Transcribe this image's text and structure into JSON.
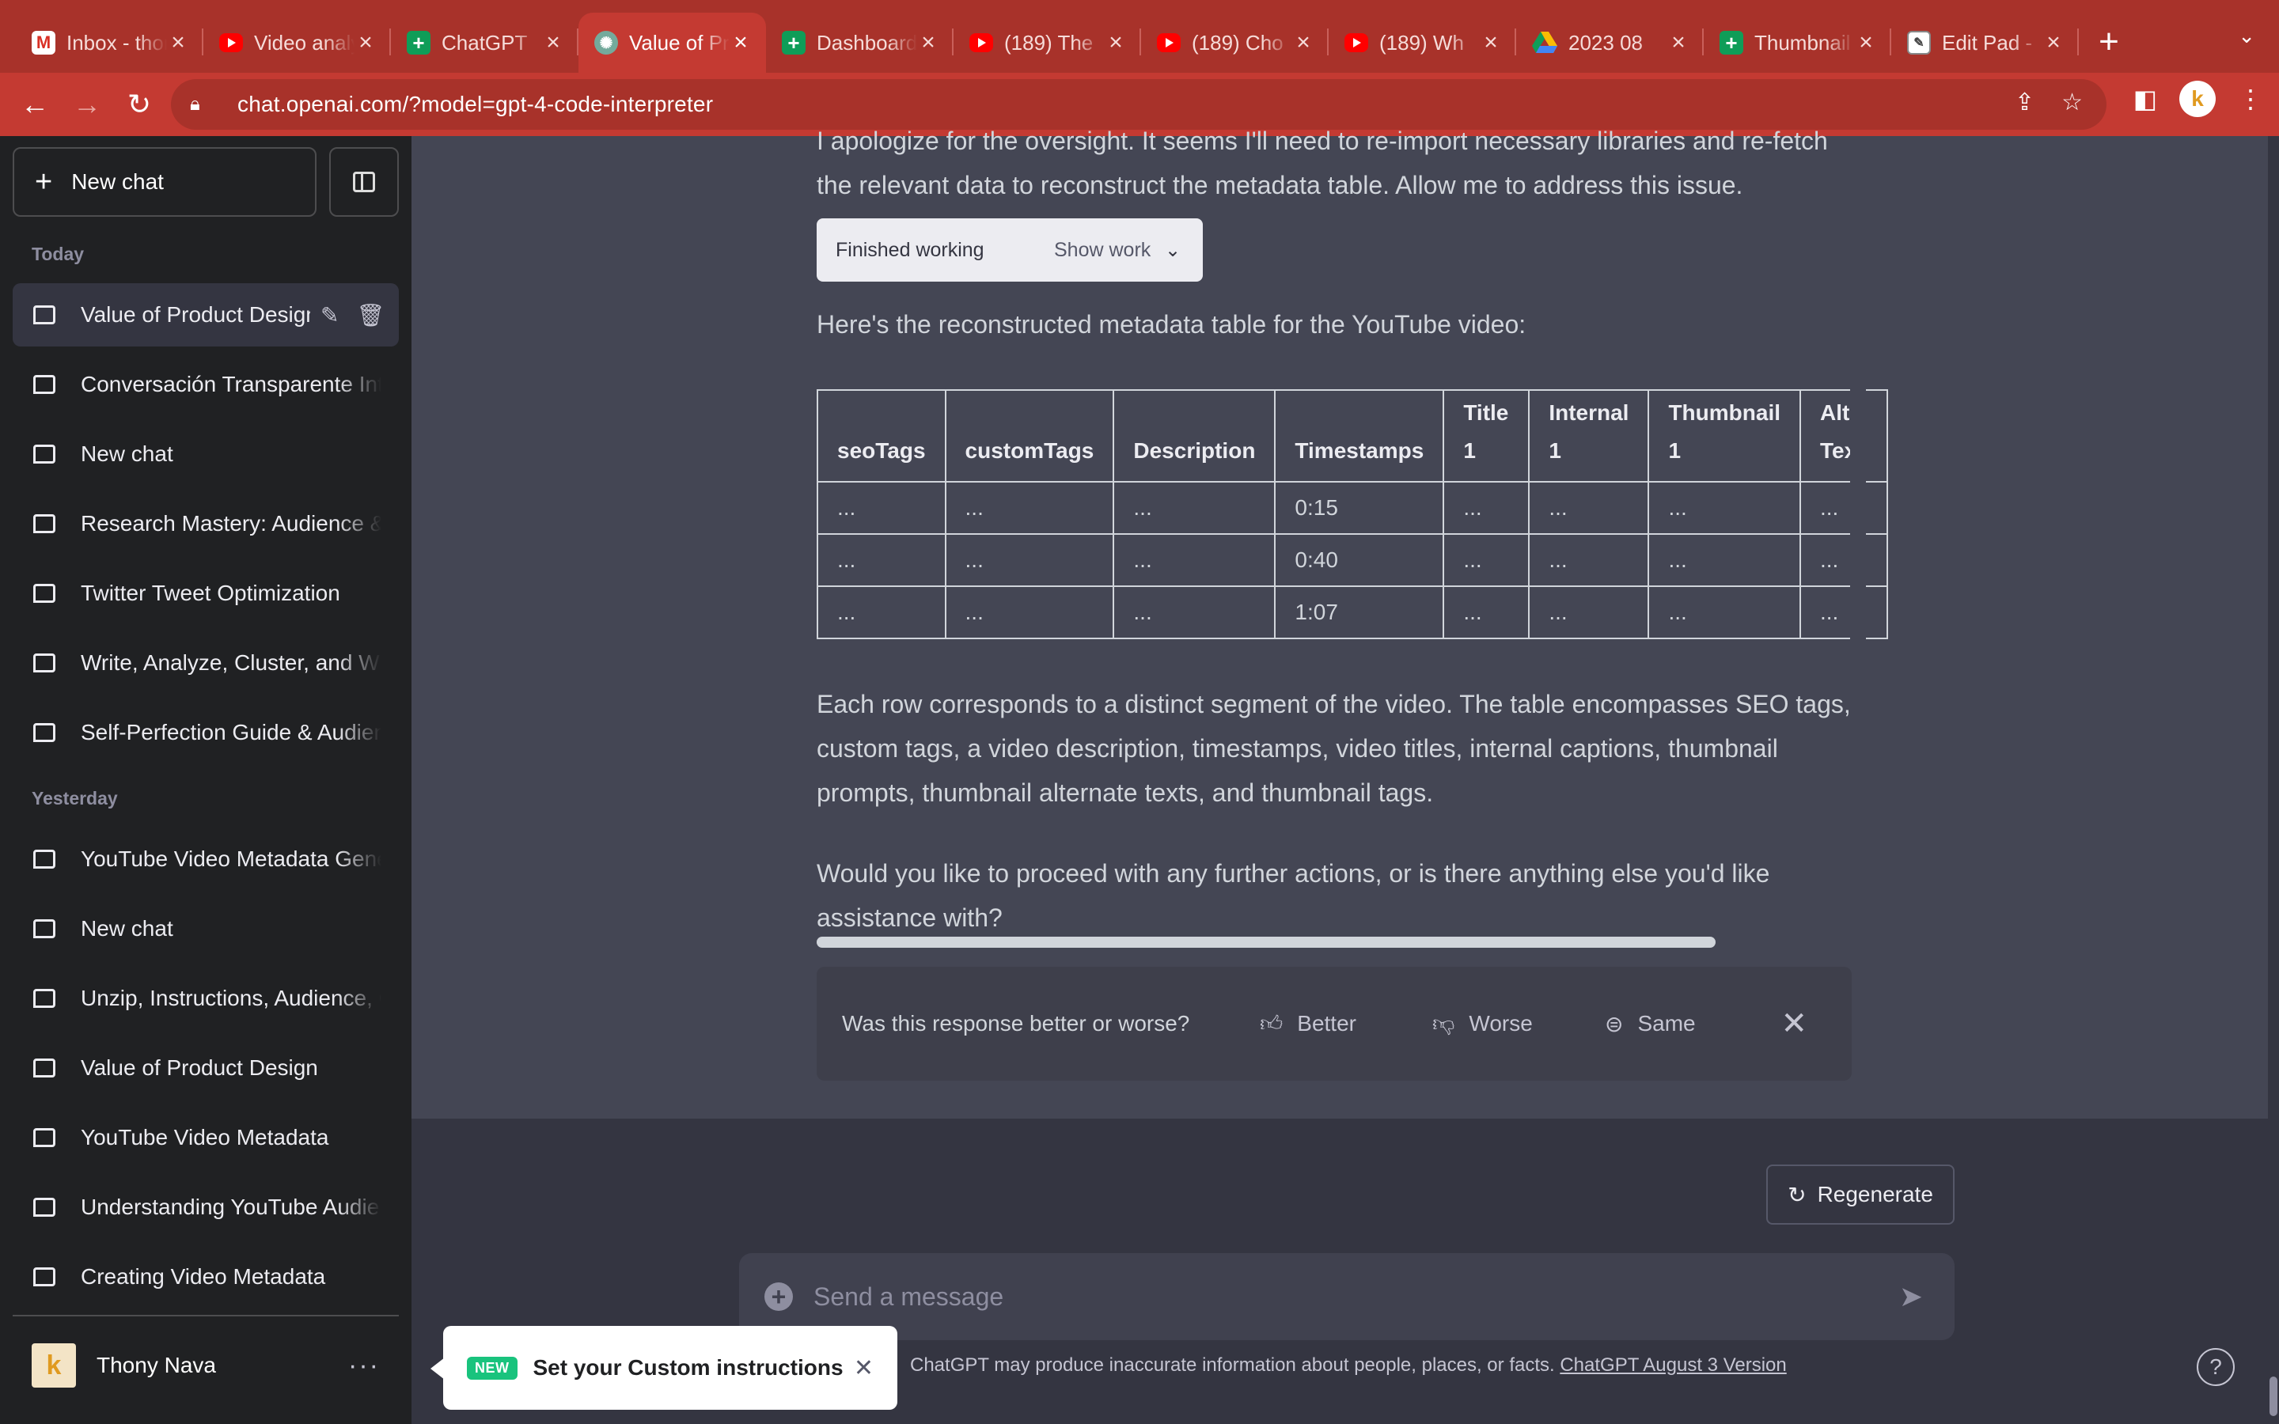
{
  "browser": {
    "tabs": [
      {
        "title": "Inbox - thony",
        "icon": "gmail-icon"
      },
      {
        "title": "Video analysis",
        "icon": "youtube-icon"
      },
      {
        "title": "ChatGPT",
        "icon": "sheets-icon"
      },
      {
        "title": "Value of Product",
        "icon": "chatgpt-icon"
      },
      {
        "title": "Dashboard",
        "icon": "sheets-icon"
      },
      {
        "title": "(189) The",
        "icon": "youtube-icon"
      },
      {
        "title": "(189) Cho",
        "icon": "youtube-icon"
      },
      {
        "title": "(189) Wh",
        "icon": "youtube-icon"
      },
      {
        "title": "2023 08",
        "icon": "drive-icon"
      },
      {
        "title": "Thumbnail",
        "icon": "sheets-icon"
      },
      {
        "title": "Edit Pad -",
        "icon": "editpad-icon"
      }
    ],
    "active_tab": 3,
    "url": "chat.openai.com/?model=gpt-4-code-interpreter",
    "profile_initial": "k"
  },
  "sidebar": {
    "new_chat_label": "New chat",
    "today_label": "Today",
    "yesterday_label": "Yesterday",
    "today_items": [
      "Value of Product Design",
      "Conversación Transparente Interna",
      "New chat",
      "Research Mastery: Audience & Goals",
      "Twitter Tweet Optimization",
      "Write, Analyze, Cluster, and Write",
      "Self-Perfection Guide & Audience"
    ],
    "yesterday_items": [
      "YouTube Video Metadata Generation",
      "New chat",
      "Unzip, Instructions, Audience, Goals",
      "Value of Product Design",
      "YouTube Video Metadata",
      "Understanding YouTube Audience",
      "Creating Video Metadata"
    ],
    "user_name": "Thony Nava",
    "user_initial": "k"
  },
  "conversation": {
    "intro_text": "I apologize for the oversight. It seems I'll need to re-import necessary libraries and re-fetch the relevant data to reconstruct the metadata table. Allow me to address this issue.",
    "finished_label": "Finished working",
    "show_work_label": "Show work",
    "table_intro": "Here's the reconstructed metadata table for the YouTube video:",
    "table": {
      "headers": [
        "seoTags",
        "customTags",
        "Description",
        "Timestamps",
        "Title 1",
        "Internal 1",
        "Thumbnail 1",
        "Alt Text"
      ],
      "rows": [
        [
          "...",
          "...",
          "...",
          "0:15",
          "...",
          "...",
          "...",
          "..."
        ],
        [
          "...",
          "...",
          "...",
          "0:40",
          "...",
          "...",
          "...",
          "..."
        ],
        [
          "...",
          "...",
          "...",
          "1:07",
          "...",
          "...",
          "...",
          "..."
        ]
      ]
    },
    "summary_text": "Each row corresponds to a distinct segment of the video. The table encompasses SEO tags, custom tags, a video description, timestamps, video titles, internal captions, thumbnail prompts, thumbnail alternate texts, and thumbnail tags.",
    "followup_text": "Would you like to proceed with any further actions, or is there anything else you'd like assistance with?"
  },
  "feedback": {
    "question": "Was this response better or worse?",
    "better": "Better",
    "worse": "Worse",
    "same": "Same"
  },
  "composer": {
    "regenerate_label": "Regenerate",
    "placeholder": "Send a message",
    "disclaimer": "ChatGPT may produce inaccurate information about people, places, or facts.",
    "version_link": "ChatGPT August 3 Version",
    "help": "?"
  },
  "toast": {
    "badge": "NEW",
    "text": "Set your Custom instructions"
  }
}
